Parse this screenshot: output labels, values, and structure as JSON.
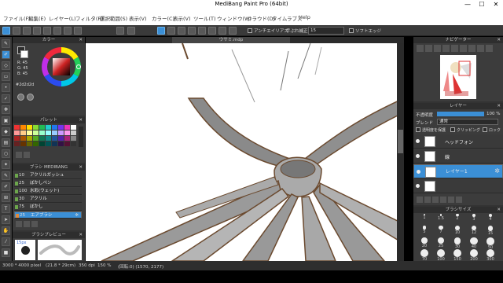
{
  "window": {
    "title": "MediBang Paint Pro (64bit)",
    "minimize": "—",
    "maximize": "☐",
    "close": "✕"
  },
  "menu": [
    "ファイル(F)",
    "編集(E)",
    "レイヤー(L)",
    "フィルタ(R)",
    "選択範囲(S)",
    "表示(V)",
    "カラー(C)",
    "表示(V)",
    "ツール(T)",
    "ウィンドウ(W)",
    "クラウド(D)",
    "タイムラプス",
    "Help"
  ],
  "toolbar": {
    "antialias_label": "アンチエイリアス",
    "correction_label": "手ぶれ補正",
    "correction_value": "15",
    "softedge_label": "ソフトエッジ"
  },
  "left": {
    "color_header": "カラー",
    "color_values": [
      "R: 45",
      "G: 45",
      "B: 45"
    ],
    "color_hex": "#2d2d2d",
    "palette_header": "パレット",
    "brush_header": "ブラシ MEDIBANG",
    "brushes": [
      {
        "size": "10",
        "name": "アクリルガッシュ",
        "color": "#6ca64c"
      },
      {
        "size": "25",
        "name": "ぼかしペン",
        "color": "#6ca64c"
      },
      {
        "size": "100",
        "name": "水彩(ウェット)",
        "color": "#6ca64c"
      },
      {
        "size": "30",
        "name": "アクリル",
        "color": "#6ca64c"
      },
      {
        "size": "75",
        "name": "ぼかし",
        "color": "#6ca64c"
      },
      {
        "size": "25",
        "name": "エアブラシ",
        "color": "#e08a3c"
      }
    ],
    "brush_preview_header": "ブラシプレビュー",
    "brush_preview_size": "15px"
  },
  "canvas": {
    "doc_tab": "ウサミ.mdp"
  },
  "right": {
    "navigator_header": "ナビゲーター",
    "layer_header": "レイヤー",
    "opacity_label": "不透明度",
    "opacity_value": "100 %",
    "blend_label": "ブレンド",
    "blend_value": "通常",
    "protect_label": "透明度を保護",
    "clip_label": "クリッピング",
    "lock_label": "ロック",
    "layers": [
      {
        "name": "ヘッドフォン",
        "selected": false
      },
      {
        "name": "線",
        "selected": false
      },
      {
        "name": "レイヤー1",
        "selected": true
      },
      {
        "name": "",
        "selected": false
      }
    ],
    "brush_size_header": "ブラシサイズ",
    "brush_sizes": [
      "1",
      "1.5",
      "2",
      "3",
      "4",
      "5",
      "7",
      "10",
      "12",
      "15",
      "20",
      "25",
      "30",
      "40",
      "50",
      "70",
      "100",
      "150",
      "200",
      "300"
    ]
  },
  "status": {
    "dims": "3000 * 4000 pixel",
    "cm": "(21.8 * 29cm)",
    "dpi": "350 dpi",
    "zoom": "150 %",
    "coords": "(回転:0) (1570, 2177)"
  },
  "colors": {
    "accent": "#3b8fd6",
    "panel": "#3c3c3c",
    "line": "#6b4a2f",
    "shadow": "#8f8f8f"
  }
}
